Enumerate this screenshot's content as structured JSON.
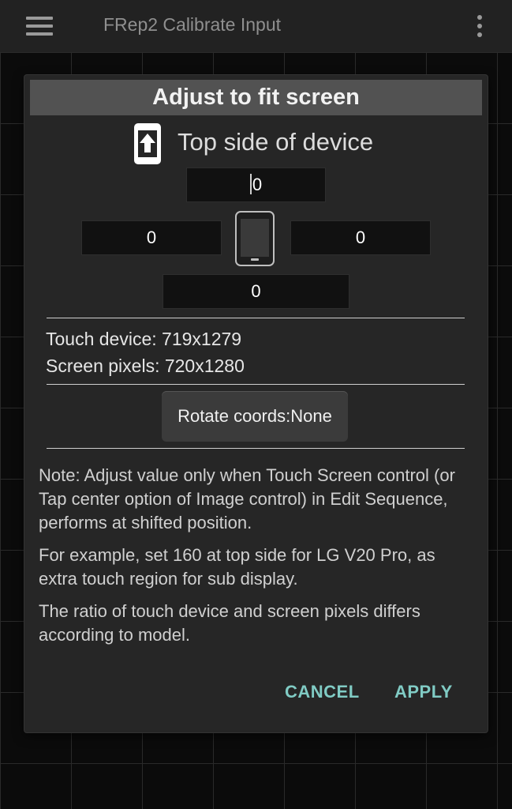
{
  "appbar": {
    "title": "FRep2 Calibrate Input",
    "menu_icon": "hamburger-menu-icon",
    "overflow_icon": "vertical-dots-icon"
  },
  "dialog": {
    "title": "Adjust to fit screen",
    "top_side_label": "Top side of device",
    "fields": {
      "top": "0",
      "left": "0",
      "right": "0",
      "bottom": "0"
    },
    "touch_device": "Touch device: 719x1279",
    "screen_pixels": "Screen pixels: 720x1280",
    "rotate_label": "Rotate coords:None",
    "notes": [
      "Note: Adjust value only when Touch Screen control (or Tap center option of Image control) in Edit Sequence, performs at shifted position.",
      "For example, set 160 at top side for LG V20 Pro, as extra touch region for sub display.",
      "The ratio of touch device and screen pixels differs according to model."
    ],
    "cancel_label": "CANCEL",
    "apply_label": "APPLY"
  },
  "colors": {
    "accent": "#80cbc4",
    "dialog_bg": "#262626",
    "title_bg": "#525252",
    "appbar_bg": "#222222"
  }
}
